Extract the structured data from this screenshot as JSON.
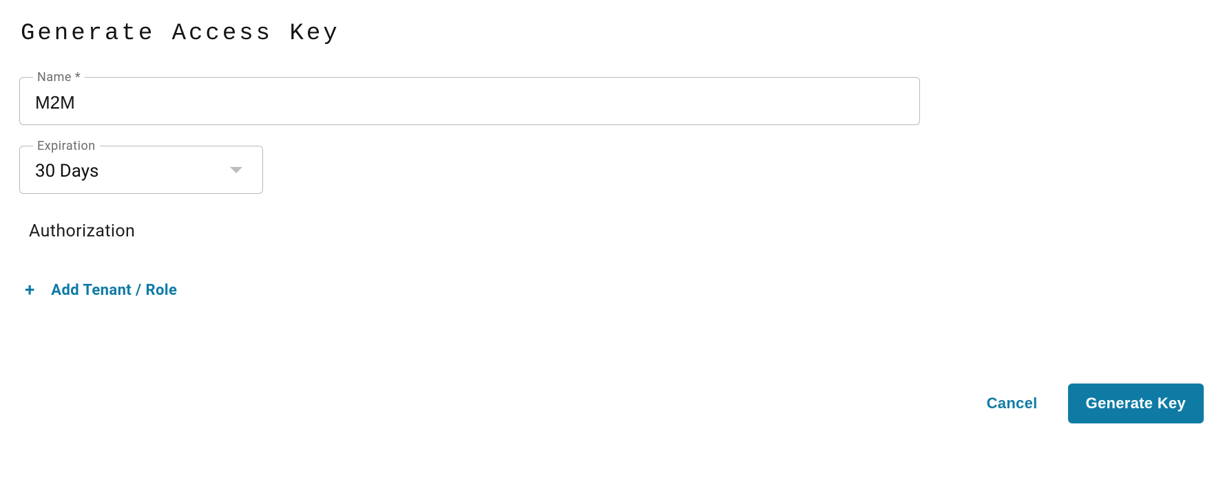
{
  "title": "Generate Access Key",
  "form": {
    "name_label": "Name *",
    "name_value": "M2M",
    "expiration_label": "Expiration",
    "expiration_value": "30 Days"
  },
  "authorization": {
    "heading": "Authorization",
    "add_label": "Add Tenant / Role"
  },
  "actions": {
    "cancel": "Cancel",
    "generate": "Generate Key"
  }
}
